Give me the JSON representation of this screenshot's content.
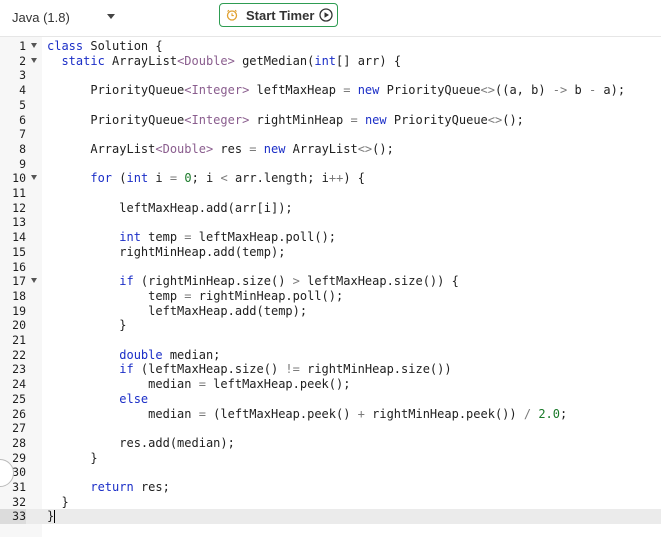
{
  "toolbar": {
    "language": "Java (1.8)",
    "timer_label": "Start Timer",
    "accent_color": "#2e9c52"
  },
  "editor": {
    "line_numbers": [
      "1",
      "2",
      "3",
      "4",
      "5",
      "6",
      "7",
      "8",
      "9",
      "10",
      "11",
      "12",
      "13",
      "14",
      "15",
      "16",
      "17",
      "18",
      "19",
      "20",
      "21",
      "22",
      "23",
      "24",
      "25",
      "26",
      "27",
      "28",
      "29",
      "30",
      "31",
      "32",
      "33"
    ],
    "fold_lines": [
      1,
      2,
      10,
      17
    ],
    "active_line": 33,
    "lines": [
      "class Solution {",
      "  static ArrayList<Double> getMedian(int[] arr) {",
      "",
      "      PriorityQueue<Integer> leftMaxHeap = new PriorityQueue<>((a, b) -> b - a);",
      "",
      "      PriorityQueue<Integer> rightMinHeap = new PriorityQueue<>();",
      "",
      "      ArrayList<Double> res = new ArrayList<>();",
      "",
      "      for (int i = 0; i < arr.length; i++) {",
      "",
      "          leftMaxHeap.add(arr[i]);",
      "",
      "          int temp = leftMaxHeap.poll();",
      "          rightMinHeap.add(temp);",
      "",
      "          if (rightMinHeap.size() > leftMaxHeap.size()) {",
      "              temp = rightMinHeap.poll();",
      "              leftMaxHeap.add(temp);",
      "          }",
      "",
      "          double median;",
      "          if (leftMaxHeap.size() != rightMinHeap.size())",
      "              median = leftMaxHeap.peek();",
      "          else",
      "              median = (leftMaxHeap.peek() + rightMinHeap.peek()) / 2.0;",
      "",
      "          res.add(median);",
      "      }",
      "",
      "      return res;",
      "  }",
      "}"
    ]
  }
}
